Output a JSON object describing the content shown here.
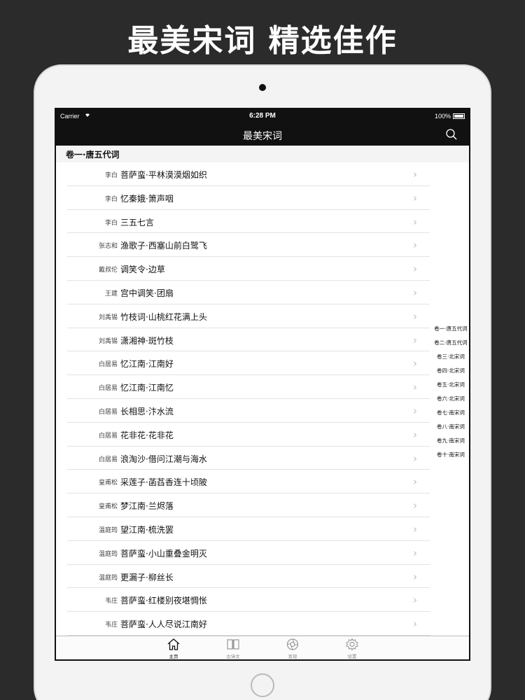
{
  "promo": {
    "title": "最美宋词 精选佳作"
  },
  "status_bar": {
    "carrier": "Carrier",
    "time": "6:28 PM",
    "battery": "100%"
  },
  "nav": {
    "title": "最美宋词",
    "search_icon": "search-icon"
  },
  "section": {
    "title": "卷一·唐五代词"
  },
  "rows": [
    {
      "author": "李白",
      "title": "菩萨蛮·平林漠漠烟如织"
    },
    {
      "author": "李白",
      "title": "忆秦娥·箫声咽"
    },
    {
      "author": "李白",
      "title": "三五七言"
    },
    {
      "author": "张志和",
      "title": "渔歌子·西塞山前白鹭飞"
    },
    {
      "author": "戴叔伦",
      "title": "调笑令·边草"
    },
    {
      "author": "王建",
      "title": "宫中调笑·团扇"
    },
    {
      "author": "刘禹锡",
      "title": "竹枝词·山桃红花满上头"
    },
    {
      "author": "刘禹锡",
      "title": "潇湘神·斑竹枝"
    },
    {
      "author": "白居易",
      "title": "忆江南·江南好"
    },
    {
      "author": "白居易",
      "title": "忆江南·江南忆"
    },
    {
      "author": "白居易",
      "title": "长相思·汴水流"
    },
    {
      "author": "白居易",
      "title": "花非花·花非花"
    },
    {
      "author": "白居易",
      "title": "浪淘沙·借问江潮与海水"
    },
    {
      "author": "皇甫松",
      "title": "采莲子·菡萏香连十顷陂"
    },
    {
      "author": "皇甫松",
      "title": "梦江南·兰烬落"
    },
    {
      "author": "温庭筠",
      "title": "望江南·梳洗罢"
    },
    {
      "author": "温庭筠",
      "title": "菩萨蛮·小山重叠金明灭"
    },
    {
      "author": "温庭筠",
      "title": "更漏子·柳丝长"
    },
    {
      "author": "韦庄",
      "title": "菩萨蛮·红楼别夜堪惆怅"
    },
    {
      "author": "韦庄",
      "title": "菩萨蛮·人人尽说江南好"
    }
  ],
  "index": [
    "卷一·唐五代词",
    "卷二·唐五代词",
    "卷三·北宋词",
    "卷四·北宋词",
    "卷五·北宋词",
    "卷六·北宋词",
    "卷七·南宋词",
    "卷八·南宋词",
    "卷九·南宋词",
    "卷十·南宋词"
  ],
  "tabs": [
    {
      "label": "主页",
      "icon": "home-icon",
      "active": true
    },
    {
      "label": "古诗文",
      "icon": "book-icon",
      "active": false
    },
    {
      "label": "发现",
      "icon": "discover-icon",
      "active": false
    },
    {
      "label": "设置",
      "icon": "gear-icon",
      "active": false
    }
  ],
  "colors": {
    "bar": "#111111",
    "background": "#2b2b2b",
    "chevron": "#bdbdbd"
  }
}
